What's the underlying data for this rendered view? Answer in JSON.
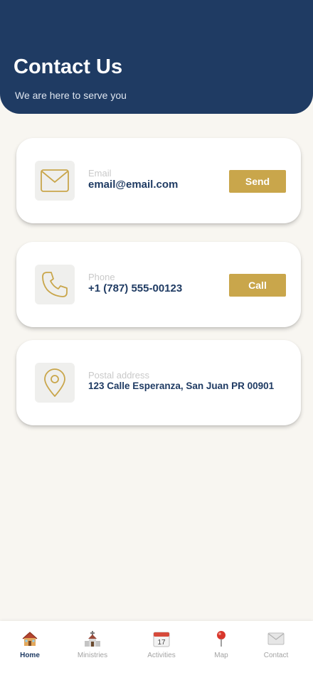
{
  "header": {
    "title": "Contact Us",
    "subtitle": "We are here to serve you"
  },
  "contacts": [
    {
      "label": "Email",
      "value": "email@email.com",
      "action": "Send",
      "icon": "envelope-icon"
    },
    {
      "label": "Phone",
      "value": "+1 (787) 555-00123",
      "action": "Call",
      "icon": "phone-icon"
    },
    {
      "label": "Postal address",
      "value": "123 Calle Esperanza, San Juan PR 00901",
      "icon": "location-pin-icon"
    }
  ],
  "nav": {
    "active": "Home",
    "items": [
      {
        "label": "Home",
        "icon": "house-icon"
      },
      {
        "label": "Ministries",
        "icon": "church-icon"
      },
      {
        "label": "Activities",
        "icon": "calendar-icon"
      },
      {
        "label": "Map",
        "icon": "map-pin-icon"
      },
      {
        "label": "Contact",
        "icon": "mail-icon"
      }
    ]
  },
  "colors": {
    "primary": "#1f3b63",
    "accent": "#c9a64b",
    "background": "#f8f6f1"
  }
}
